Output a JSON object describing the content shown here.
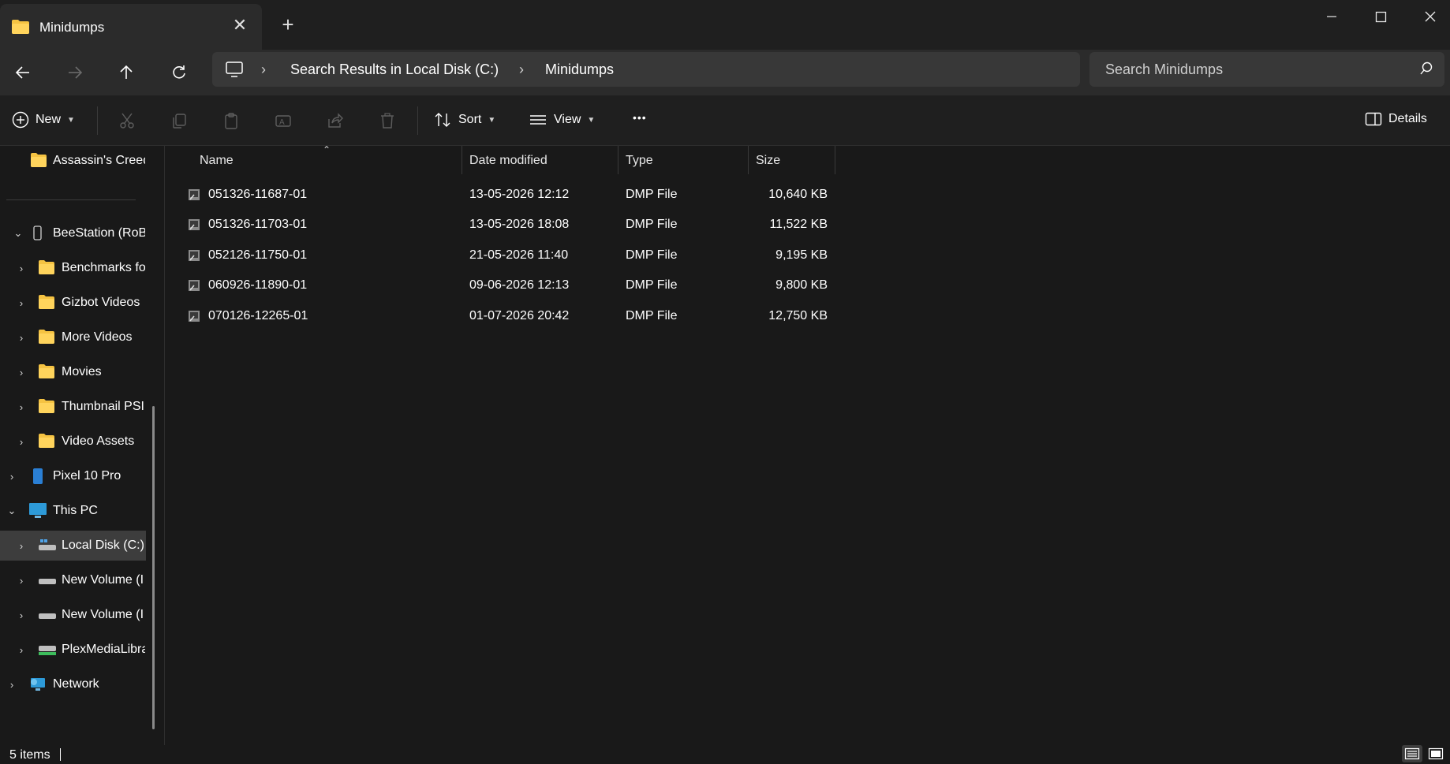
{
  "window": {
    "tab_title": "Minidumps",
    "tab_close": "✕",
    "new_tab": "+"
  },
  "address_bar": {
    "crumbs": [
      "Search Results in Local Disk (C:)",
      "Minidumps"
    ],
    "search_placeholder": "Search Minidumps"
  },
  "command_bar": {
    "new_label": "New",
    "sort_label": "Sort",
    "view_label": "View",
    "more_label": "•••",
    "details_label": "Details"
  },
  "nav_pane": {
    "items": [
      {
        "label": "Assassin's Creed",
        "icon": "folder-icon"
      },
      {
        "label": "BeeStation (RoB",
        "icon": "nas-icon"
      },
      {
        "label": "Benchmarks fo",
        "icon": "folder-icon"
      },
      {
        "label": "Gizbot Videos",
        "icon": "folder-icon"
      },
      {
        "label": "More Videos",
        "icon": "folder-icon"
      },
      {
        "label": "Movies",
        "icon": "folder-icon"
      },
      {
        "label": "Thumbnail PSI",
        "icon": "folder-icon"
      },
      {
        "label": "Video Assets",
        "icon": "folder-icon"
      },
      {
        "label": "Pixel 10 Pro",
        "icon": "phone-icon"
      },
      {
        "label": "This PC",
        "icon": "pc-icon"
      },
      {
        "label": "Local Disk (C:)",
        "icon": "system-drive-icon"
      },
      {
        "label": "New Volume (I",
        "icon": "drive-icon"
      },
      {
        "label": "New Volume (I",
        "icon": "drive-icon"
      },
      {
        "label": "PlexMediaLibra",
        "icon": "network-drive-icon"
      },
      {
        "label": "Network",
        "icon": "network-icon"
      }
    ]
  },
  "file_list": {
    "columns": {
      "name": "Name",
      "date": "Date modified",
      "type": "Type",
      "size": "Size"
    },
    "rows": [
      {
        "name": "051326-11687-01",
        "date": "13-05-2026 12:12",
        "type": "DMP File",
        "size": "10,640 KB"
      },
      {
        "name": "051326-11703-01",
        "date": "13-05-2026 18:08",
        "type": "DMP File",
        "size": "11,522 KB"
      },
      {
        "name": "052126-11750-01",
        "date": "21-05-2026 11:40",
        "type": "DMP File",
        "size": "9,195 KB"
      },
      {
        "name": "060926-11890-01",
        "date": "09-06-2026 12:13",
        "type": "DMP File",
        "size": "9,800 KB"
      },
      {
        "name": "070126-12265-01",
        "date": "01-07-2026 20:42",
        "type": "DMP File",
        "size": "12,750 KB"
      }
    ]
  },
  "status_bar": {
    "item_count": "5 items"
  },
  "colors": {
    "background": "#191919",
    "toolbar": "#2b2b2b",
    "folder": "#f5c342",
    "selection": "#3d3d3d"
  }
}
